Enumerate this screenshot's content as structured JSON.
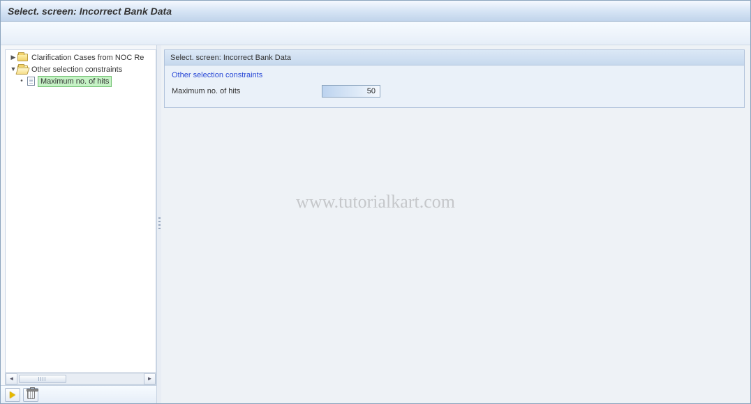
{
  "title": "Select. screen: Incorrect Bank Data",
  "watermark": "www.tutorialkart.com",
  "tree": {
    "items": [
      {
        "label": "Clarification Cases from NOC Re",
        "expanded": false,
        "type": "folder-closed"
      },
      {
        "label": "Other selection constraints",
        "expanded": true,
        "type": "folder-open",
        "children": [
          {
            "label": "Maximum no. of hits",
            "type": "doc",
            "selected": true
          }
        ]
      }
    ]
  },
  "panel": {
    "header": "Select. screen: Incorrect Bank Data",
    "section_title": "Other selection constraints",
    "form": {
      "max_hits_label": "Maximum no. of hits",
      "max_hits_value": "50"
    }
  }
}
